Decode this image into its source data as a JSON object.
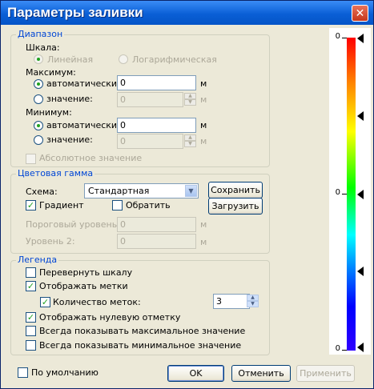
{
  "window": {
    "title": "Параметры заливки",
    "close_glyph": "✕"
  },
  "range": {
    "title": "Диапазон",
    "scale_label": "Шкала:",
    "scale_linear": "Линейная",
    "scale_log": "Логарифмическая",
    "max_label": "Максимум:",
    "max_auto": "автоматически",
    "max_auto_value": "0",
    "max_value_label": "значение:",
    "max_value": "0",
    "unit": "м",
    "min_label": "Минимум:",
    "min_auto": "автоматически",
    "min_auto_value": "0",
    "min_value_label": "значение:",
    "min_value": "0",
    "absolute": "Абсолютное значение"
  },
  "palette": {
    "title": "Цветовая гамма",
    "scheme_label": "Схема:",
    "scheme_value": "Стандартная",
    "save": "Сохранить",
    "gradient": "Градиент",
    "invert": "Обратить",
    "load": "Загрузить",
    "threshold_label": "Пороговый уровень:",
    "threshold_value": "0",
    "level2_label": "Уровень 2:",
    "level2_value": "0",
    "unit": "м"
  },
  "legend": {
    "title": "Легенда",
    "flip_scale": "Перевернуть шкалу",
    "show_marks": "Отображать метки",
    "marks_count_label": "Количество меток:",
    "marks_count": "3",
    "show_zero": "Отображать нулевую отметку",
    "show_max": "Всегда показывать максимальное значение",
    "show_min": "Всегда показывать минимальное значение"
  },
  "footer": {
    "default_label": "По умолчанию",
    "ok": "OK",
    "cancel": "Отменить",
    "apply": "Применить"
  },
  "colorbar": {
    "labels": [
      "0",
      "0",
      "0"
    ],
    "colors": [
      "#ff0000",
      "#ffff00",
      "#00ff00",
      "#00ffff",
      "#0000ff"
    ]
  },
  "icons": {
    "check": "✓",
    "arrow_up": "▲",
    "arrow_down": "▼"
  }
}
